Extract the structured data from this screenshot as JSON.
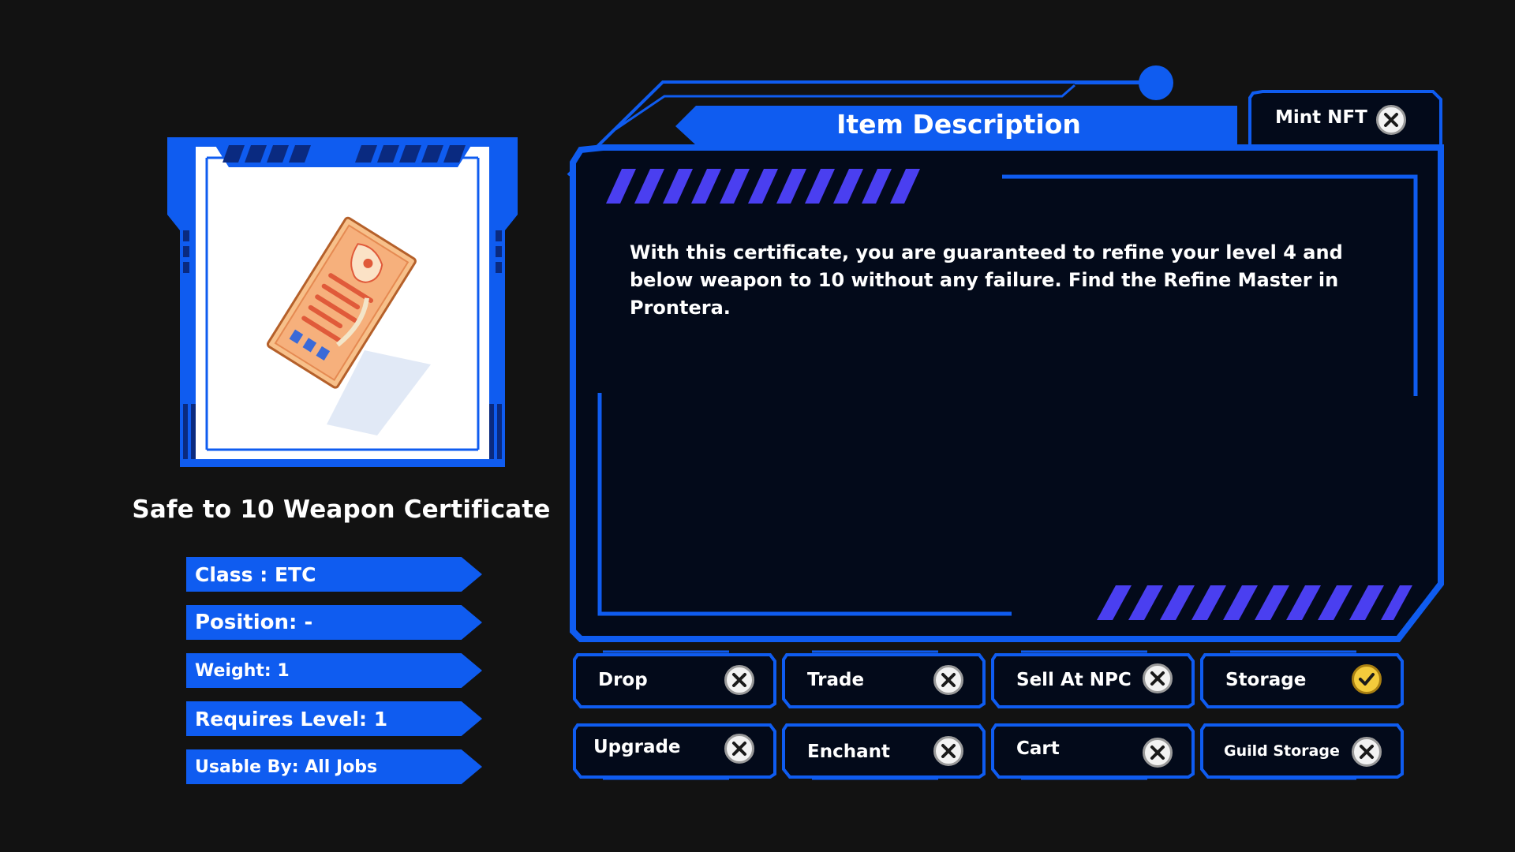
{
  "item": {
    "name": "Safe to 10 Weapon Certificate",
    "image_icon": "certificate-scroll-icon"
  },
  "stats": [
    {
      "label": "Class : ETC"
    },
    {
      "label": "Position: -"
    },
    {
      "label": "Weight: 1"
    },
    {
      "label": "Requires Level: 1"
    },
    {
      "label": "Usable By: All Jobs"
    }
  ],
  "description": {
    "title": "Item Description",
    "text": "With this certificate, you are guaranteed to refine your level 4 and below weapon to 10 without any failure. Find the Refine Master in Prontera."
  },
  "mint": {
    "label": "Mint NFT",
    "allowed": false
  },
  "permissions": [
    {
      "label": "Drop",
      "allowed": false
    },
    {
      "label": "Trade",
      "allowed": false
    },
    {
      "label": "Sell At NPC",
      "allowed": false
    },
    {
      "label": "Storage",
      "allowed": true
    },
    {
      "label": "Upgrade",
      "allowed": false
    },
    {
      "label": "Enchant",
      "allowed": false
    },
    {
      "label": "Cart",
      "allowed": false
    },
    {
      "label": "Guild Storage",
      "allowed": false
    }
  ],
  "colors": {
    "accent": "#0f5cf0",
    "accent_dark": "#0b3fb8",
    "stripe": "#4a3ff0",
    "panel_bg": "#030a1a",
    "allowed": "#f3cb3c",
    "denied": "#f2f2f2"
  }
}
